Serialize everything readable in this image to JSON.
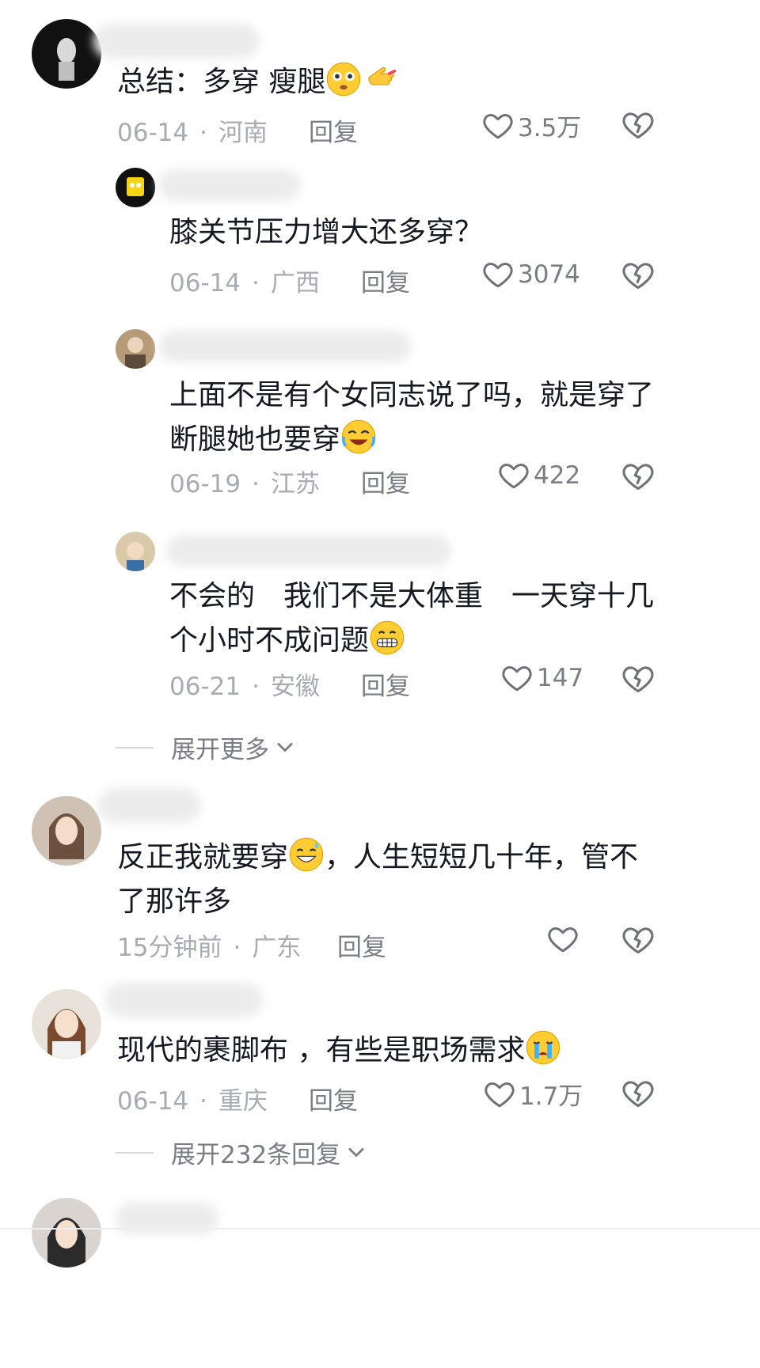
{
  "comments": [
    {
      "text": "总结：多穿 瘦腿",
      "date": "06-14",
      "region": "河南",
      "reply": "回复",
      "likes": "3.5万",
      "emojis": [
        "flushed-face-emoji",
        "pointing-hand-emoji"
      ],
      "replies": [
        {
          "text": "膝关节压力增大还多穿？",
          "date": "06-14",
          "region": "广西",
          "reply": "回复",
          "likes": "3074"
        },
        {
          "text": "上面不是有个女同志说了吗，就是穿了断腿她也要穿",
          "date": "06-19",
          "region": "江苏",
          "reply": "回复",
          "likes": "422",
          "emojis": [
            "rolling-laughing-emoji"
          ]
        },
        {
          "text": "不会的　我们不是大体重　一天穿十几个小时不成问题",
          "date": "06-21",
          "region": "安徽",
          "reply": "回复",
          "likes": "147",
          "emojis": [
            "grinning-face-emoji"
          ]
        }
      ],
      "expand": "展开更多"
    },
    {
      "text1": "反正我就要穿",
      "text2": "，人生短短几十年，管不了那许多",
      "date": "15分钟前",
      "region": "广东",
      "reply": "回复",
      "likes": "",
      "emojis": [
        "sweat-smile-emoji"
      ]
    },
    {
      "text": "现代的裹脚布 ，有些是职场需求",
      "date": "06-14",
      "region": "重庆",
      "reply": "回复",
      "likes": "1.7万",
      "emojis": [
        "crying-face-emoji"
      ],
      "expand": "展开232条回复"
    }
  ],
  "colors": {
    "text": "#161823",
    "meta": "#a9abb3",
    "action": "#7b7d85"
  }
}
